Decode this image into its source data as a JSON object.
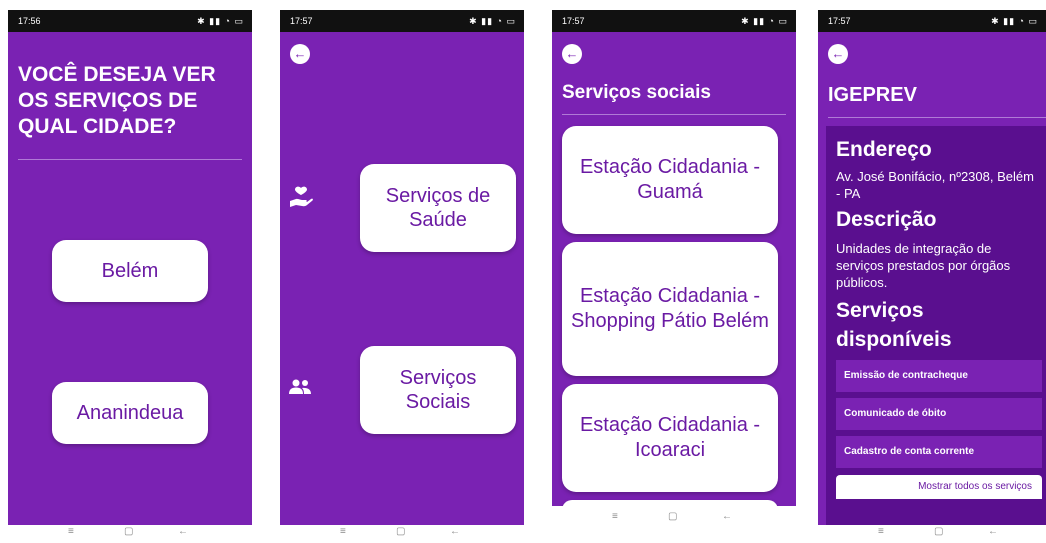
{
  "screens": [
    {
      "status_time": "17:56",
      "question": "VOCÊ DESEJA VER OS SERVIÇOS DE QUAL CIDADE?",
      "cities": [
        "Belém",
        "Ananindeua"
      ]
    },
    {
      "status_time": "17:57",
      "back_icon": "arrow-left-icon",
      "services": [
        {
          "label": "Serviços de Saúde",
          "icon": "heart-hand-icon"
        },
        {
          "label": "Serviços Sociais",
          "icon": "people-icon"
        }
      ]
    },
    {
      "status_time": "17:57",
      "title": "Serviços sociais",
      "stations": [
        "Estação Cidadania - Guamá",
        "Estação Cidadania - Shopping Pátio Belém",
        "Estação Cidadania - Icoaraci"
      ]
    },
    {
      "status_time": "17:57",
      "title": "IGEPREV",
      "address_heading": "Endereço",
      "address": "Av. José Bonifácio, nº2308, Belém - PA",
      "description_heading": "Descrição",
      "description": "Unidades de integração de serviços prestados por órgãos públicos.",
      "services_heading": "Serviços disponíveis",
      "services": [
        "Emissão de contracheque",
        "Comunicado de óbito",
        "Cadastro de conta corrente"
      ],
      "show_all": "Mostrar todos os serviços"
    }
  ],
  "colors": {
    "purple": "#7a22b3",
    "dark_purple": "#5a0f8f",
    "white": "#ffffff"
  }
}
